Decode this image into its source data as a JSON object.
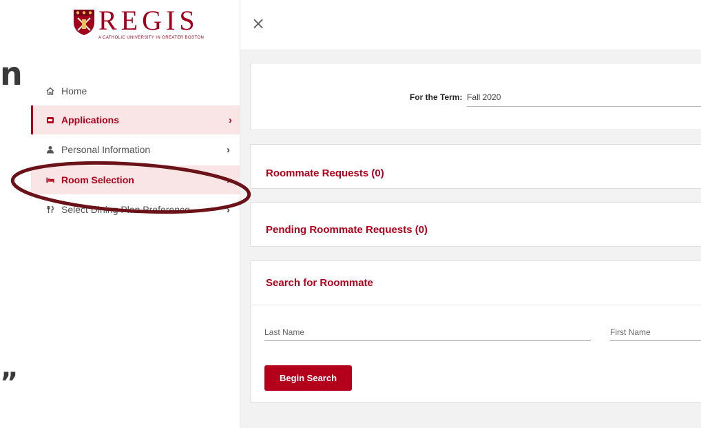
{
  "background": {
    "fragment_top": "n",
    "fragment_bottom": "”"
  },
  "logo": {
    "name": "REGIS",
    "tagline": "A CATHOLIC UNIVERSITY IN GREATER BOSTON"
  },
  "nav": {
    "items": [
      {
        "label": "Home",
        "icon": "home-icon"
      },
      {
        "label": "Applications",
        "icon": "application-icon",
        "active": true
      },
      {
        "label": "Personal Information",
        "icon": "user-icon"
      },
      {
        "label": "Room Selection",
        "icon": "bed-icon",
        "active": true
      },
      {
        "label": "Select Dining Plan Preference",
        "icon": "dining-icon"
      }
    ],
    "chevron": "›"
  },
  "topbar": {
    "close_icon": "×"
  },
  "term": {
    "label": "For the Term:",
    "value": "Fall 2020"
  },
  "sections": {
    "roommate_requests": "Roommate Requests (0)",
    "pending_requests": "Pending Roommate Requests (0)",
    "search_title": "Search for Roommate"
  },
  "search": {
    "last_name_label": "Last Name",
    "first_name_label": "First Name",
    "button_label": "Begin Search"
  },
  "colors": {
    "accent": "#b3001b",
    "active_bg": "#f9e5e6",
    "highlight_ring": "#6b1218"
  }
}
